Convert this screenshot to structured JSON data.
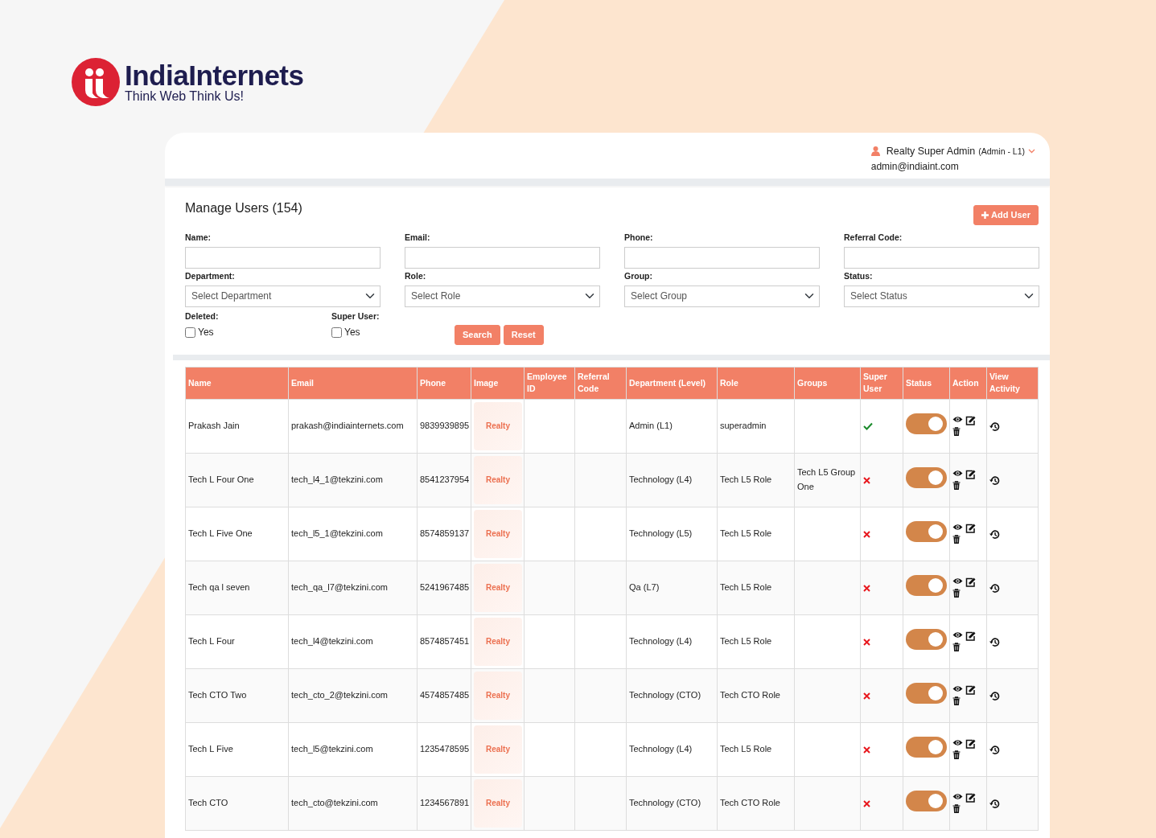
{
  "brand": {
    "name": "IndiaInternets",
    "tagline": "Think Web Think Us!"
  },
  "user": {
    "name": "Realty Super Admin",
    "role": "(Admin - L1)",
    "email": "admin@indiaint.com"
  },
  "page": {
    "title": "Manage Users (154)",
    "add_button": "Add User"
  },
  "filters": [
    {
      "kind": "text",
      "label": "Name:"
    },
    {
      "kind": "text",
      "label": "Email:"
    },
    {
      "kind": "text",
      "label": "Phone:"
    },
    {
      "kind": "text",
      "label": "Referral Code:"
    },
    {
      "kind": "select",
      "label": "Department:",
      "value": "Select Department"
    },
    {
      "kind": "select",
      "label": "Role:",
      "value": "Select Role"
    },
    {
      "kind": "select",
      "label": "Group:",
      "value": "Select Group"
    },
    {
      "kind": "select",
      "label": "Status:",
      "value": "Select Status"
    }
  ],
  "checks": [
    {
      "label": "Deleted:",
      "option": "Yes",
      "checked": false
    },
    {
      "label": "Super User:",
      "option": "Yes",
      "checked": false
    }
  ],
  "buttons": [
    "Search",
    "Reset"
  ],
  "table": {
    "columns": [
      "Name",
      "Email",
      "Phone",
      "Image",
      "Employee ID",
      "Referral Code",
      "Department (Level)",
      "Role",
      "Groups",
      "Super User",
      "Status",
      "Action",
      "View Activity"
    ],
    "rows": [
      {
        "name": "Prakash Jain",
        "email": "prakash@indiainternets.com",
        "phone": "9839939895",
        "image_logo": "Realty",
        "department": "Admin (L1)",
        "role": "superadmin",
        "groups": "",
        "super_user": true,
        "status_on": true
      },
      {
        "name": "Tech L Four One",
        "email": "tech_l4_1@tekzini.com",
        "phone": "8541237954",
        "image_logo": "Realty",
        "department": "Technology (L4)",
        "role": "Tech L5 Role",
        "groups": "Tech L5 Group One",
        "super_user": false,
        "status_on": true
      },
      {
        "name": "Tech L Five One",
        "email": "tech_l5_1@tekzini.com",
        "phone": "8574859137",
        "image_logo": "Realty",
        "department": "Technology (L5)",
        "role": "Tech L5 Role",
        "groups": "",
        "super_user": false,
        "status_on": true
      },
      {
        "name": "Tech qa l seven",
        "email": "tech_qa_l7@tekzini.com",
        "phone": "5241967485",
        "image_logo": "Realty",
        "department": "Qa (L7)",
        "role": "Tech L5 Role",
        "groups": "",
        "super_user": false,
        "status_on": true
      },
      {
        "name": "Tech L Four",
        "email": "tech_l4@tekzini.com",
        "phone": "8574857451",
        "image_logo": "Realty",
        "department": "Technology (L4)",
        "role": "Tech L5 Role",
        "groups": "",
        "super_user": false,
        "status_on": true
      },
      {
        "name": "Tech CTO Two",
        "email": "tech_cto_2@tekzini.com",
        "phone": "4574857485",
        "image_logo": "Realty",
        "department": "Technology (CTO)",
        "role": "Tech CTO Role",
        "groups": "",
        "super_user": false,
        "status_on": true
      },
      {
        "name": "Tech L Five",
        "email": "tech_l5@tekzini.com",
        "phone": "1235478595",
        "image_logo": "Realty",
        "department": "Technology (L4)",
        "role": "Tech L5 Role",
        "groups": "",
        "super_user": false,
        "status_on": true
      },
      {
        "name": "Tech CTO",
        "email": "tech_cto@tekzini.com",
        "phone": "1234567891",
        "image_logo": "Realty",
        "department": "Technology (CTO)",
        "role": "Tech CTO Role",
        "groups": "",
        "super_user": false,
        "status_on": true
      }
    ]
  }
}
